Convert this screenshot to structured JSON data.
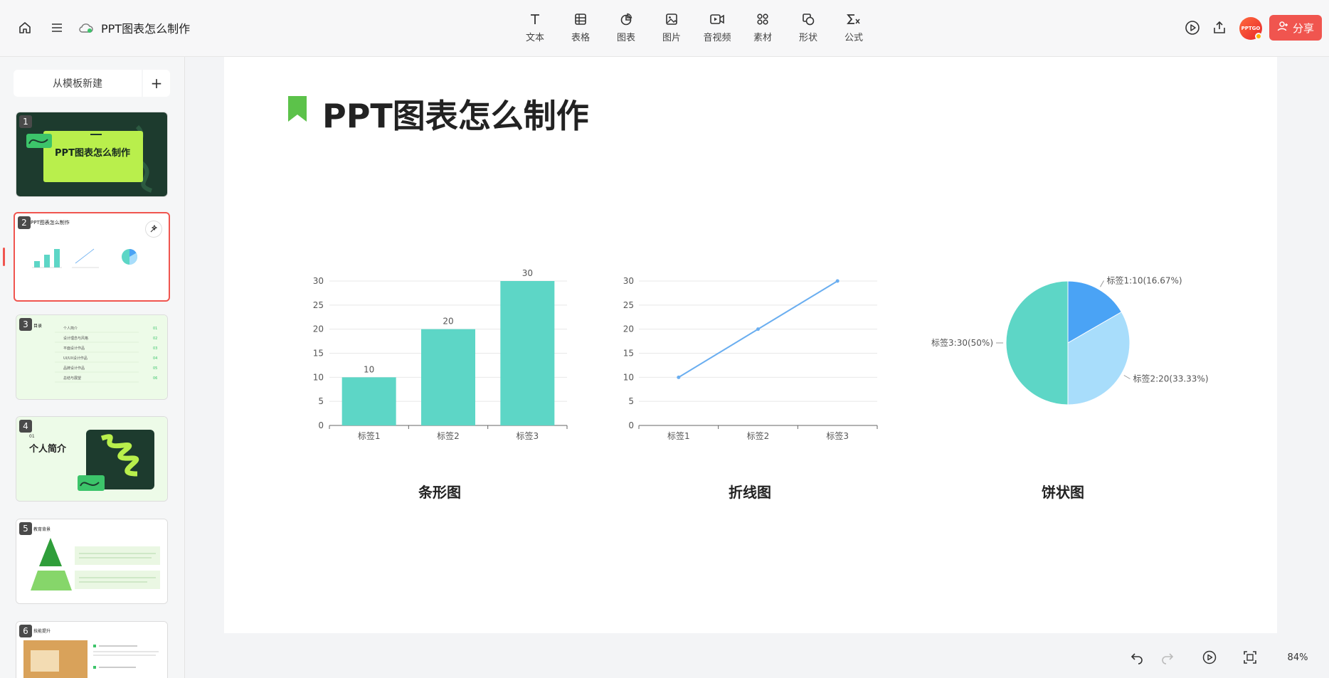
{
  "header": {
    "doc_title": "PPT图表怎么制作",
    "tools": [
      {
        "label": "文本",
        "icon": "text-icon"
      },
      {
        "label": "表格",
        "icon": "table-icon"
      },
      {
        "label": "图表",
        "icon": "chart-icon"
      },
      {
        "label": "图片",
        "icon": "image-icon"
      },
      {
        "label": "音视频",
        "icon": "video-icon"
      },
      {
        "label": "素材",
        "icon": "material-icon"
      },
      {
        "label": "形状",
        "icon": "shape-icon"
      },
      {
        "label": "公式",
        "icon": "formula-icon"
      }
    ],
    "avatar_text": "PPTGO",
    "share_label": "分享"
  },
  "sidebar": {
    "new_from_template": "从模板新建",
    "add": "+",
    "slides": [
      {
        "num": "1",
        "title": "PPT图表怎么制作"
      },
      {
        "num": "2",
        "title": "PPT图表怎么制作"
      },
      {
        "num": "3",
        "title": "目录",
        "items": [
          "个人简介",
          "设计理念与风格",
          "平面设计作品",
          "UI/UX设计作品",
          "品牌设计作品",
          "总结与展望"
        ],
        "nums": [
          "01",
          "02",
          "03",
          "04",
          "05",
          "06"
        ]
      },
      {
        "num": "4",
        "title": "个人简介",
        "sub": "01"
      },
      {
        "num": "5",
        "title": "教育背景"
      },
      {
        "num": "6",
        "title": "技能提升"
      }
    ]
  },
  "slide": {
    "title": "PPT图表怎么制作",
    "captions": [
      "条形图",
      "折线图",
      "饼状图"
    ]
  },
  "bottom": {
    "zoom": "84%"
  },
  "chart_data": [
    {
      "type": "bar",
      "categories": [
        "标签1",
        "标签2",
        "标签3"
      ],
      "values": [
        10,
        20,
        30
      ],
      "ylim": [
        0,
        30
      ],
      "yticks": [
        0,
        5,
        10,
        15,
        20,
        25,
        30
      ],
      "color": "#5dd6c6",
      "title": "条形图"
    },
    {
      "type": "line",
      "categories": [
        "标签1",
        "标签2",
        "标签3"
      ],
      "values": [
        10,
        20,
        30
      ],
      "ylim": [
        0,
        30
      ],
      "yticks": [
        0,
        5,
        10,
        15,
        20,
        25,
        30
      ],
      "color": "#6aaef0",
      "title": "折线图"
    },
    {
      "type": "pie",
      "slices": [
        {
          "label": "标签1:10(16.67%)",
          "value": 10,
          "color": "#4aa3f5"
        },
        {
          "label": "标签2:20(33.33%)",
          "value": 20,
          "color": "#a8ddfb"
        },
        {
          "label": "标签3:30(50%)",
          "value": 30,
          "color": "#5dd6c6"
        }
      ],
      "title": "饼状图"
    }
  ]
}
